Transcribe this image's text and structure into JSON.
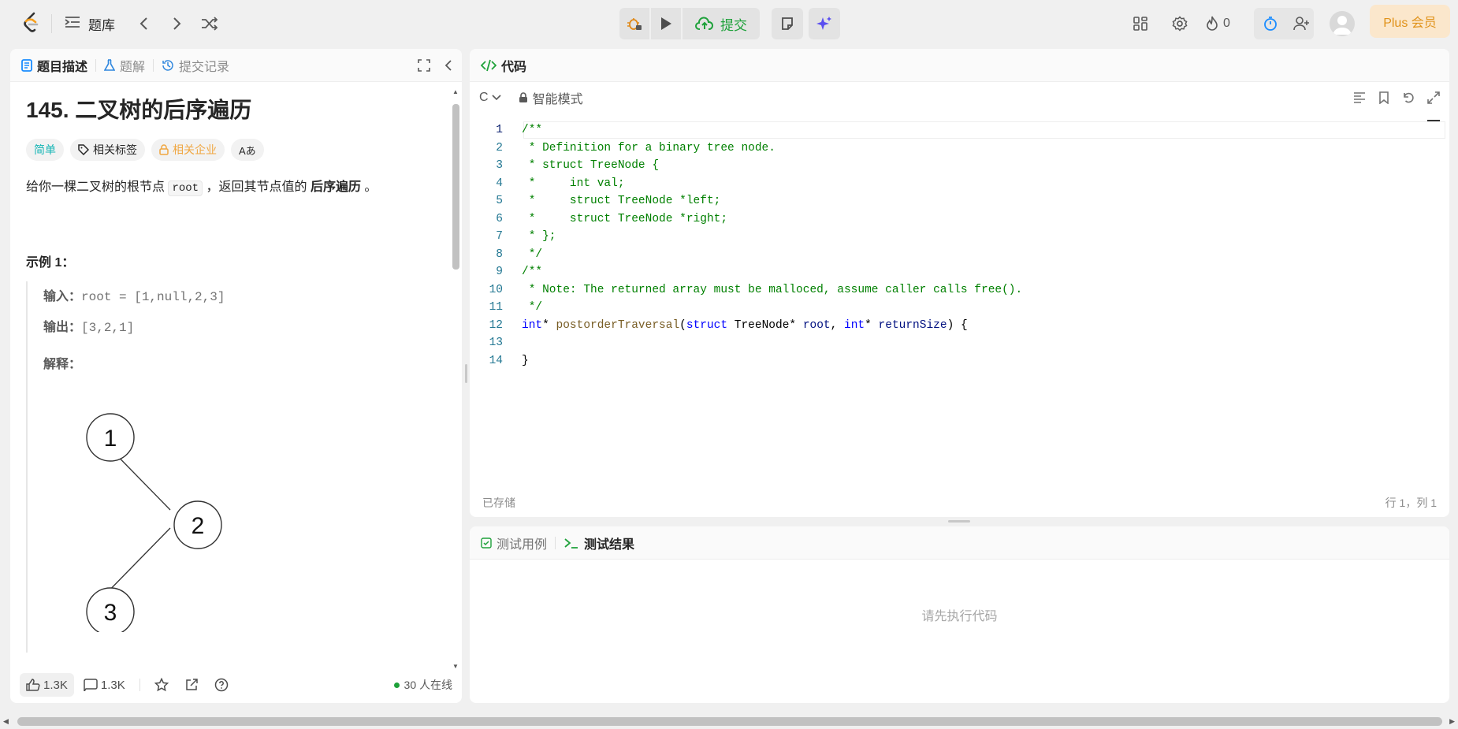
{
  "topbar": {
    "problem_list": "题库",
    "submit": "提交",
    "streak": "0",
    "plus": "Plus 会员"
  },
  "left": {
    "tabs": [
      "题目描述",
      "题解",
      "提交记录"
    ],
    "title": "145. 二叉树的后序遍历",
    "tags": [
      "简单",
      "相关标签",
      "相关企业",
      "Aあ"
    ],
    "desc_prefix": "给你一棵二叉树的根节点 ",
    "desc_code": "root",
    "desc_mid": " ，返回其节点值的 ",
    "desc_bold": "后序遍历",
    "desc_suffix": " 。",
    "example_title": "示例 1：",
    "input_label": "输入：",
    "input_val": "root = [1,null,2,3]",
    "output_label": "输出：",
    "output_val": "[3,2,1]",
    "explain_label": "解释：",
    "tree_nodes": [
      "1",
      "2",
      "3"
    ],
    "likes": "1.3K",
    "comments": "1.3K",
    "online": "30 人在线"
  },
  "editor": {
    "tab": "代码",
    "lang": "C",
    "mode": "智能模式",
    "status_saved": "已存储",
    "status_pos": "行 1，列 1",
    "lines": [
      "/**",
      " * Definition for a binary tree node.",
      " * struct TreeNode {",
      " *     int val;",
      " *     struct TreeNode *left;",
      " *     struct TreeNode *right;",
      " * };",
      " */",
      "/**",
      " * Note: The returned array must be malloced, assume caller calls free().",
      " */",
      "int* postorderTraversal(struct TreeNode* root, int* returnSize) {",
      "",
      "}"
    ]
  },
  "test": {
    "tabs": [
      "测试用例",
      "测试结果"
    ],
    "empty": "请先执行代码"
  }
}
